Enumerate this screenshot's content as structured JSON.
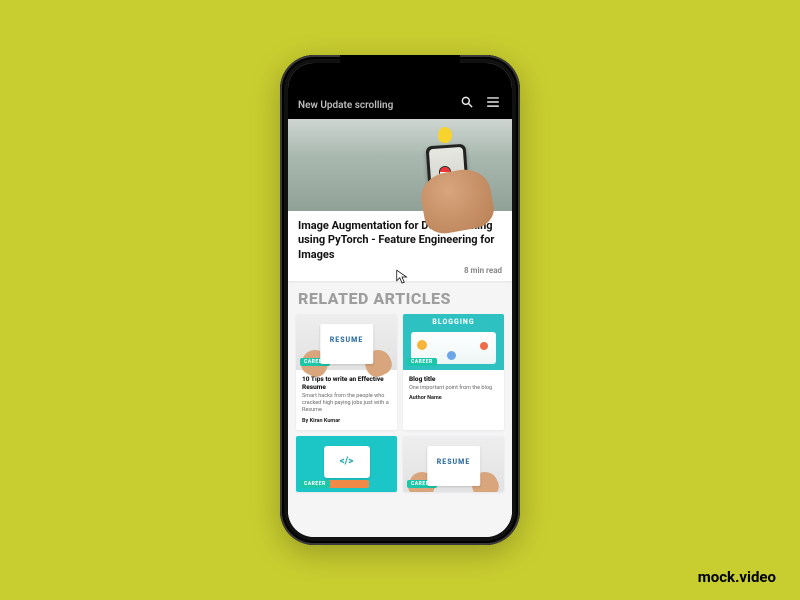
{
  "watermark": "mock.video",
  "topbar": {
    "title": "New Update scrolling",
    "search_icon": "search",
    "menu_icon": "menu"
  },
  "hero": {
    "title": "Image Augmentation for Deep Learning using PyTorch - Feature Engineering for Images",
    "read_time": "8 min read"
  },
  "section_heading": "RELATED ARTICLES",
  "cards": [
    {
      "thumb_type": "resume",
      "tag": "CAREER",
      "title": "10 Tips to write an Effective Resume",
      "subtitle": "Smart hacks from the people who cracked high paying jobs just with a Resume",
      "author": "By Kiran Kumar"
    },
    {
      "thumb_type": "blog",
      "tag": "CAREER",
      "title": "Blog title",
      "subtitle": "One important point from the blog",
      "author": "Author Name"
    },
    {
      "thumb_type": "code",
      "tag": "CAREER",
      "title": "",
      "subtitle": "",
      "author": ""
    },
    {
      "thumb_type": "resume",
      "tag": "CAREER",
      "title": "",
      "subtitle": "",
      "author": ""
    }
  ]
}
